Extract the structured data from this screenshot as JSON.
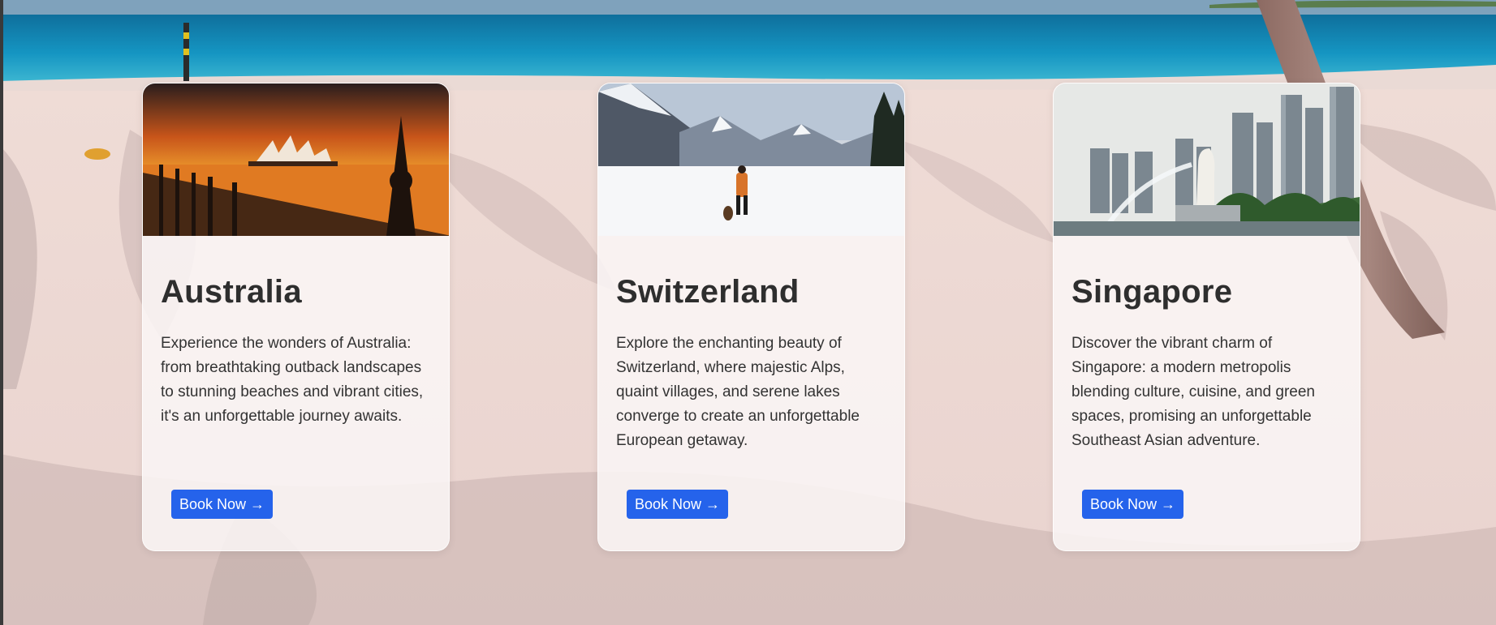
{
  "destinations": [
    {
      "name": "Australia",
      "description": "Experience the wonders of Australia: from breathtaking outback landscapes to stunning beaches and vibrant cities, it's an unforgettable journey awaits.",
      "button_label": "Book Now →",
      "image": "sydney-opera-house-sunset"
    },
    {
      "name": "Switzerland",
      "description": "Explore the enchanting beauty of Switzerland, where majestic Alps, quaint villages, and serene lakes converge to create an unforgettable European getaway.",
      "button_label": "Book Now →",
      "image": "swiss-alps-snow-hiker"
    },
    {
      "name": "Singapore",
      "description": "Discover the vibrant charm of Singapore: a modern metropolis blending culture, cuisine, and green spaces, promising an unforgettable Southeast Asian adventure.",
      "button_label": "Book Now →",
      "image": "singapore-merlion-skyline"
    }
  ],
  "background_image": "beach-sand-ocean",
  "colors": {
    "button": "#2563eb",
    "title": "#2e2e2e"
  }
}
